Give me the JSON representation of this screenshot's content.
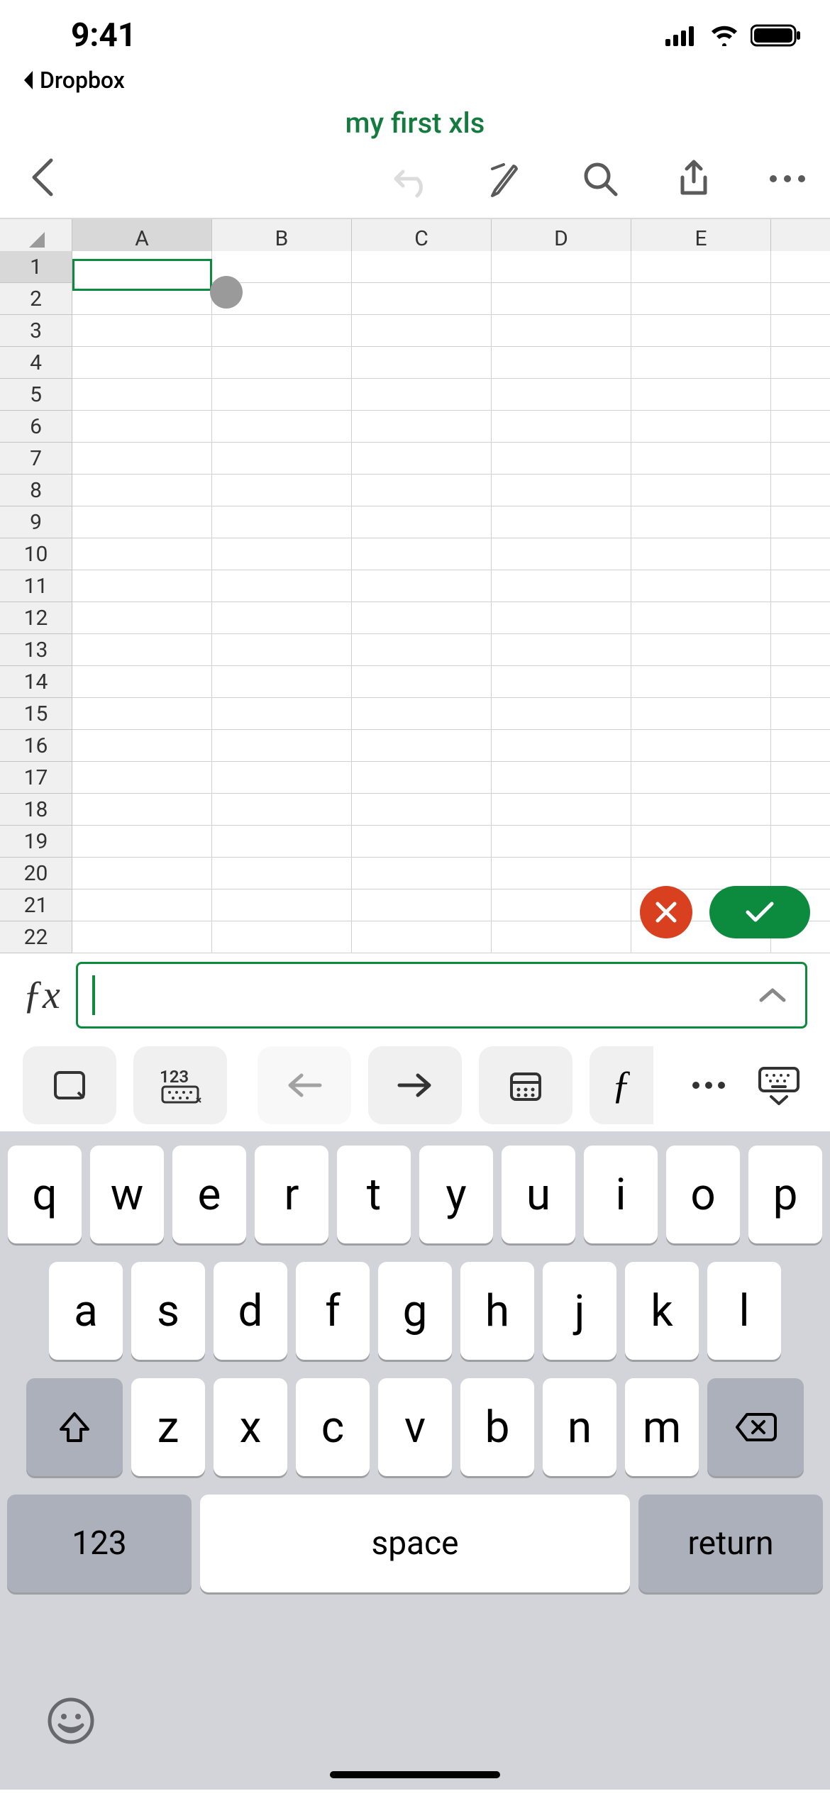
{
  "status": {
    "time": "9:41",
    "back_app": "Dropbox"
  },
  "doc": {
    "title": "my first xls"
  },
  "sheet": {
    "columns": [
      "A",
      "B",
      "C",
      "D",
      "E",
      ""
    ],
    "rows": [
      "1",
      "2",
      "3",
      "4",
      "5",
      "6",
      "7",
      "8",
      "9",
      "10",
      "11",
      "12",
      "13",
      "14",
      "15",
      "16",
      "17",
      "18",
      "19",
      "20",
      "21",
      "22"
    ],
    "active_cell": "A1"
  },
  "formula_bar": {
    "value": ""
  },
  "keyboard": {
    "row1": [
      "q",
      "w",
      "e",
      "r",
      "t",
      "y",
      "u",
      "i",
      "o",
      "p"
    ],
    "row2": [
      "a",
      "s",
      "d",
      "f",
      "g",
      "h",
      "j",
      "k",
      "l"
    ],
    "row3": [
      "z",
      "x",
      "c",
      "v",
      "b",
      "n",
      "m"
    ],
    "numbers_label": "123",
    "space_label": "space",
    "return_label": "return"
  },
  "sec_toolbar": {
    "numpad_label": "123"
  }
}
